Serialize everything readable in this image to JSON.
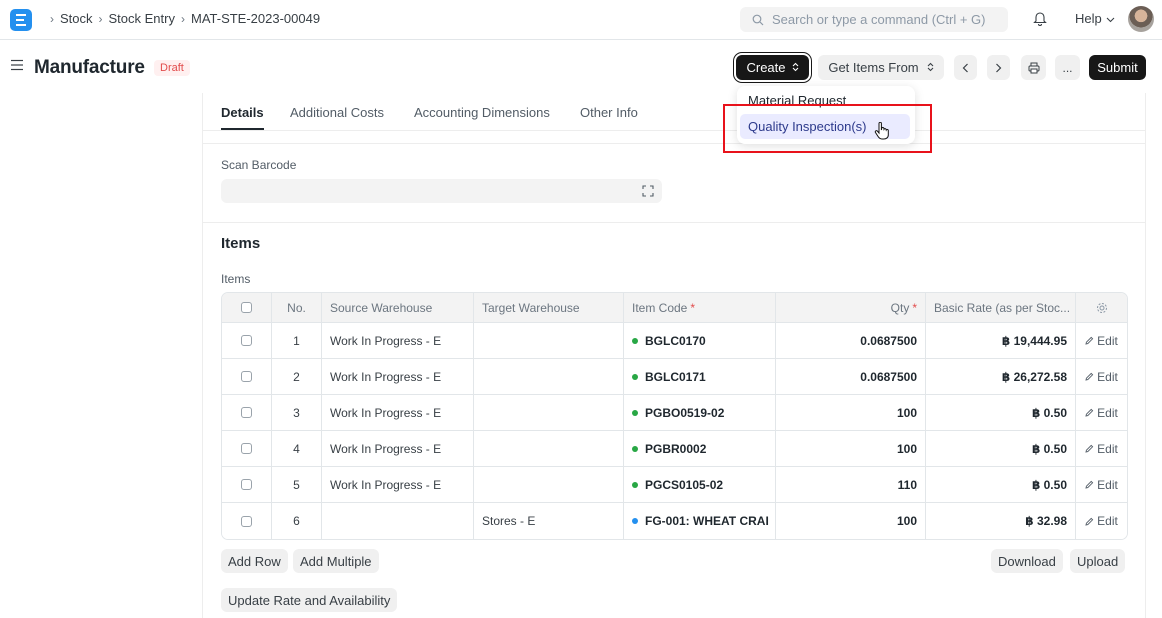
{
  "navbar": {
    "logo_letter": "E",
    "breadcrumbs": [
      "Stock",
      "Stock Entry",
      "MAT-STE-2023-00049"
    ],
    "search_placeholder": "Search or type a command (Ctrl + G)",
    "help_label": "Help"
  },
  "header": {
    "title": "Manufacture",
    "status": "Draft",
    "create_label": "Create",
    "get_items_label": "Get Items From",
    "more_label": "...",
    "submit_label": "Submit"
  },
  "create_menu": {
    "items": [
      "Material Request",
      "Quality Inspection(s)"
    ],
    "highlighted_index": 1
  },
  "tabs": [
    "Details",
    "Additional Costs",
    "Accounting Dimensions",
    "Other Info"
  ],
  "active_tab": "Details",
  "scan_barcode": {
    "label": "Scan Barcode",
    "value": ""
  },
  "items_section": {
    "title": "Items",
    "table_label": "Items",
    "columns": {
      "no": "No.",
      "source": "Source Warehouse",
      "target": "Target Warehouse",
      "item_code": "Item Code",
      "qty": "Qty",
      "rate": "Basic Rate (as per Stoc..."
    },
    "rows": [
      {
        "no": "1",
        "source": "Work In Progress - E",
        "target": "",
        "item_code": "BGLC0170",
        "qty": "0.0687500",
        "rate": "฿ 19,444.95",
        "edit": "Edit",
        "dot": "#28a745"
      },
      {
        "no": "2",
        "source": "Work In Progress - E",
        "target": "",
        "item_code": "BGLC0171",
        "qty": "0.0687500",
        "rate": "฿ 26,272.58",
        "edit": "Edit",
        "dot": "#28a745"
      },
      {
        "no": "3",
        "source": "Work In Progress - E",
        "target": "",
        "item_code": "PGBO0519-02",
        "qty": "100",
        "rate": "฿ 0.50",
        "edit": "Edit",
        "dot": "#28a745"
      },
      {
        "no": "4",
        "source": "Work In Progress - E",
        "target": "",
        "item_code": "PGBR0002",
        "qty": "100",
        "rate": "฿ 0.50",
        "edit": "Edit",
        "dot": "#28a745"
      },
      {
        "no": "5",
        "source": "Work In Progress - E",
        "target": "",
        "item_code": "PGCS0105-02",
        "qty": "110",
        "rate": "฿ 0.50",
        "edit": "Edit",
        "dot": "#28a745"
      },
      {
        "no": "6",
        "source": "",
        "target": "Stores - E",
        "item_code": "FG-001: WHEAT CRAI",
        "qty": "100",
        "rate": "฿ 32.98",
        "edit": "Edit",
        "dot": "#2490ef"
      }
    ],
    "buttons": {
      "add_row": "Add Row",
      "add_multiple": "Add Multiple",
      "download": "Download",
      "upload": "Upload",
      "update_rate": "Update Rate and Availability"
    }
  },
  "colors": {
    "primary_dark": "#171717",
    "draft_red": "#e24c4c",
    "logo_blue": "#2490ef",
    "highlight_red": "#e8121b",
    "menu_hover": "#eaebff"
  },
  "icons": [
    "search-icon",
    "bell-icon",
    "chevron-down-icon",
    "menu-icon",
    "sort-icon",
    "chevron-left-icon",
    "chevron-right-icon",
    "printer-icon",
    "scan-icon",
    "gear-icon",
    "pencil-icon",
    "hand-cursor-icon"
  ]
}
